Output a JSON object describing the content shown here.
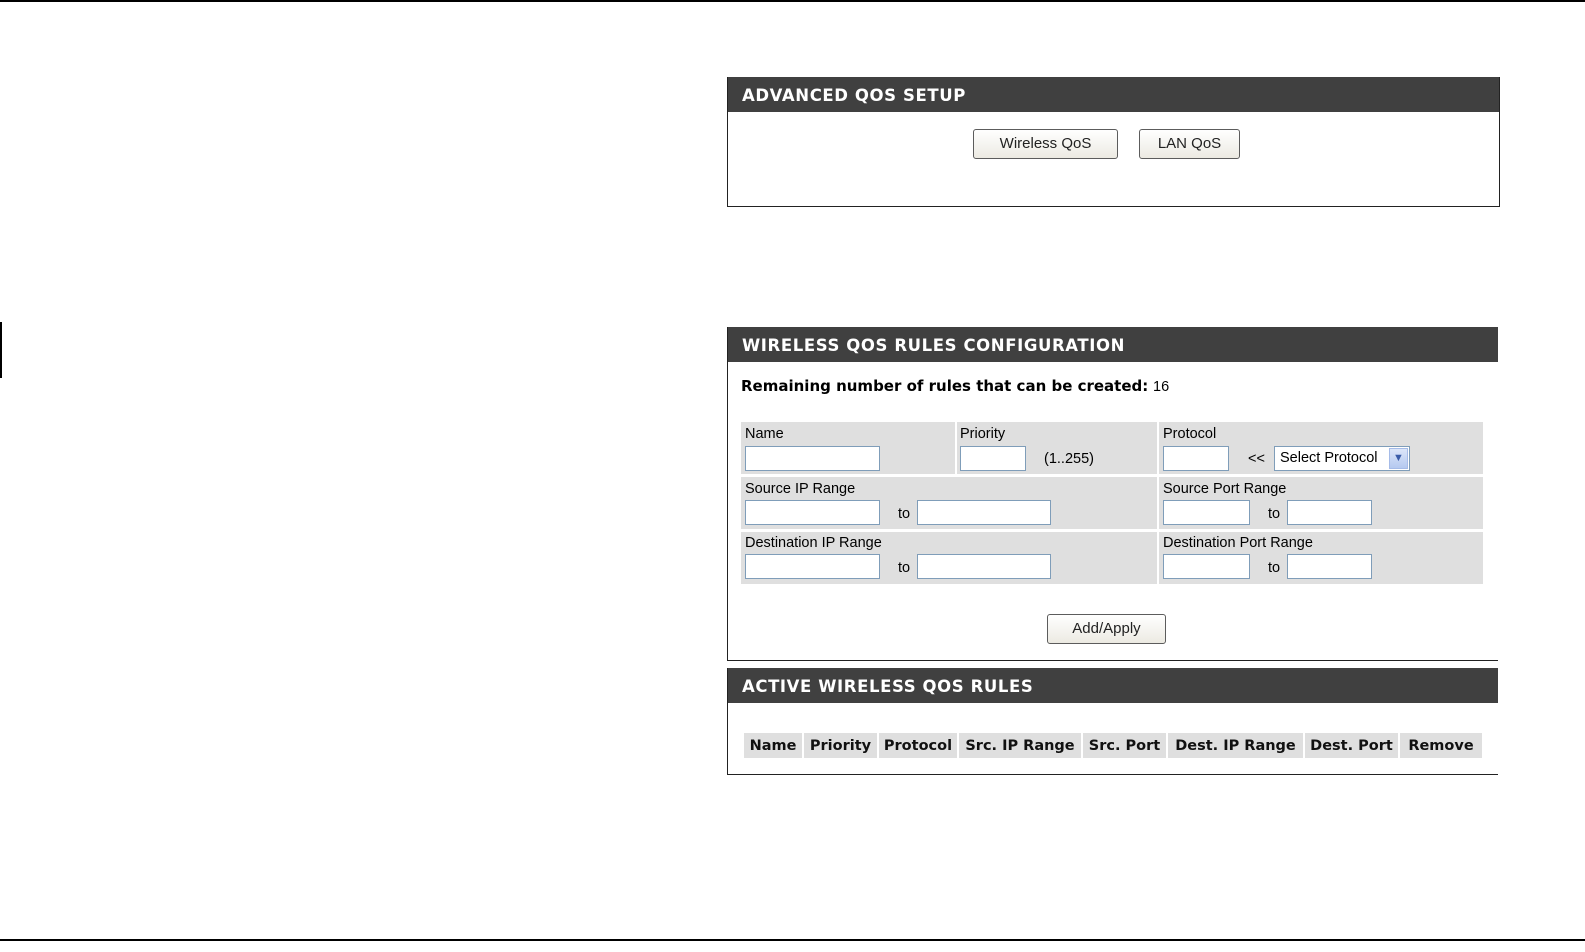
{
  "advanced_qos": {
    "title": "ADVANCED QOS SETUP",
    "wireless_qos_button": "Wireless QoS",
    "lan_qos_button": "LAN QoS"
  },
  "rules_config": {
    "title": "WIRELESS QOS RULES CONFIGURATION",
    "remaining_label": "Remaining number of rules that can be created:",
    "remaining_value": "16",
    "name_label": "Name",
    "priority_label": "Priority",
    "priority_range": "(1..255)",
    "protocol_label": "Protocol",
    "protocol_arrows": "<<",
    "protocol_select": "Select Protocol",
    "source_ip_label": "Source IP Range",
    "source_port_label": "Source Port Range",
    "dest_ip_label": "Destination IP Range",
    "dest_port_label": "Destination Port Range",
    "to_label": "to",
    "add_apply_button": "Add/Apply"
  },
  "active_rules": {
    "title": "ACTIVE WIRELESS QOS RULES",
    "columns": [
      "Name",
      "Priority",
      "Protocol",
      "Src. IP Range",
      "Src. Port",
      "Dest. IP Range",
      "Dest. Port",
      "Remove"
    ]
  }
}
